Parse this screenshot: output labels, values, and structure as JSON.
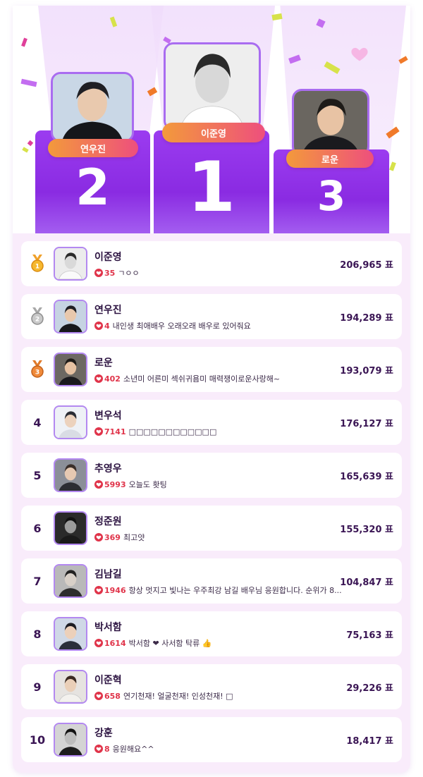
{
  "podium": [
    {
      "rank": "2",
      "name": "연우진"
    },
    {
      "rank": "1",
      "name": "이준영"
    },
    {
      "rank": "3",
      "name": "로운"
    }
  ],
  "ranking": [
    {
      "rank": "1",
      "medal": "gold-medal-icon",
      "name": "이준영",
      "hearts": "35",
      "comment": "ㄱㅇㅇ",
      "score": "206,965 표"
    },
    {
      "rank": "2",
      "medal": "silver-medal-icon",
      "name": "연우진",
      "hearts": "4",
      "comment": "내인생 최애배우 오래오래 배우로 있어줘요",
      "score": "194,289 표"
    },
    {
      "rank": "3",
      "medal": "bronze-medal-icon",
      "name": "로운",
      "hearts": "402",
      "comment": "소년미 어른미 섹쉬귀욤미 매력쟁이로운사랑해~",
      "score": "193,079 표"
    },
    {
      "rank": "4",
      "name": "변우석",
      "hearts": "7141",
      "comment": "□□□□□□□□□□□□",
      "score": "176,127 표"
    },
    {
      "rank": "5",
      "name": "추영우",
      "hearts": "5993",
      "comment": "오늘도 홧팅",
      "score": "165,639 표"
    },
    {
      "rank": "6",
      "name": "정준원",
      "hearts": "369",
      "comment": "최고얏",
      "score": "155,320 표"
    },
    {
      "rank": "7",
      "name": "김남길",
      "hearts": "1946",
      "comment": "항상 멋지고 빛나는 우주최강 남길 배우님 응원합니다. 순위가 8...",
      "score": "104,847 표"
    },
    {
      "rank": "8",
      "name": "박서함",
      "hearts": "1614",
      "comment": "박서함 ❤ 사서함 탁류 👍",
      "score": "75,163 표"
    },
    {
      "rank": "9",
      "name": "이준혁",
      "hearts": "658",
      "comment": "연기천재! 얼굴천재! 인성천재! □",
      "score": "29,226 표"
    },
    {
      "rank": "10",
      "name": "강훈",
      "hearts": "8",
      "comment": "응원해요^^",
      "score": "18,417 표"
    }
  ],
  "colors": {
    "podium": "#8a2be2",
    "pill_start": "#f39a3b",
    "pill_end": "#ee4f7d",
    "heart": "#e0344a",
    "list_bg": "#f9ecfb"
  }
}
